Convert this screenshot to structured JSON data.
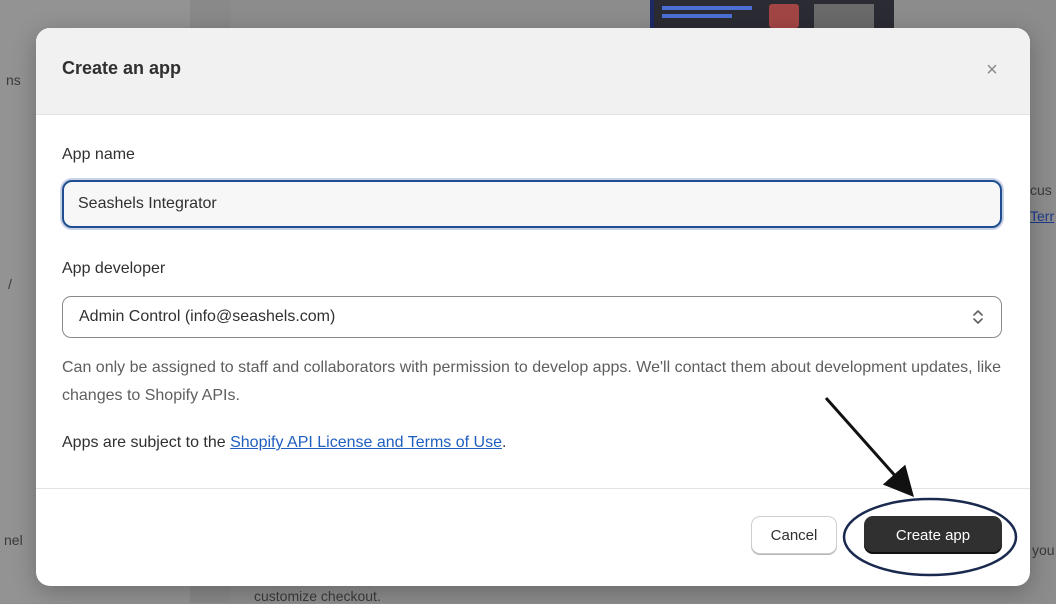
{
  "background": {
    "left_fragments": [
      "ns",
      "/",
      "nel"
    ],
    "right_fragments": [
      "cus",
      "Terr",
      "you"
    ],
    "bottom_fragment": "customize checkout."
  },
  "modal": {
    "title": "Create an app",
    "close_glyph": "×",
    "app_name": {
      "label": "App name",
      "value": "Seashels Integrator"
    },
    "app_developer": {
      "label": "App developer",
      "selected": "Admin Control (info@seashels.com)",
      "help": "Can only be assigned to staff and collaborators with permission to develop apps. We'll contact them about development updates, like changes to Shopify APIs."
    },
    "terms": {
      "prefix": "Apps are subject to the ",
      "link": "Shopify API License and Terms of Use",
      "suffix": "."
    },
    "footer": {
      "cancel_label": "Cancel",
      "create_label": "Create app"
    }
  },
  "colors": {
    "primary_button": "#303030",
    "focus_border": "#1f4d8f",
    "link": "#1f5fbf",
    "annotation": "#1a2a4f"
  },
  "icons": {
    "close": "close-icon",
    "select": "select-chevron-icon"
  }
}
